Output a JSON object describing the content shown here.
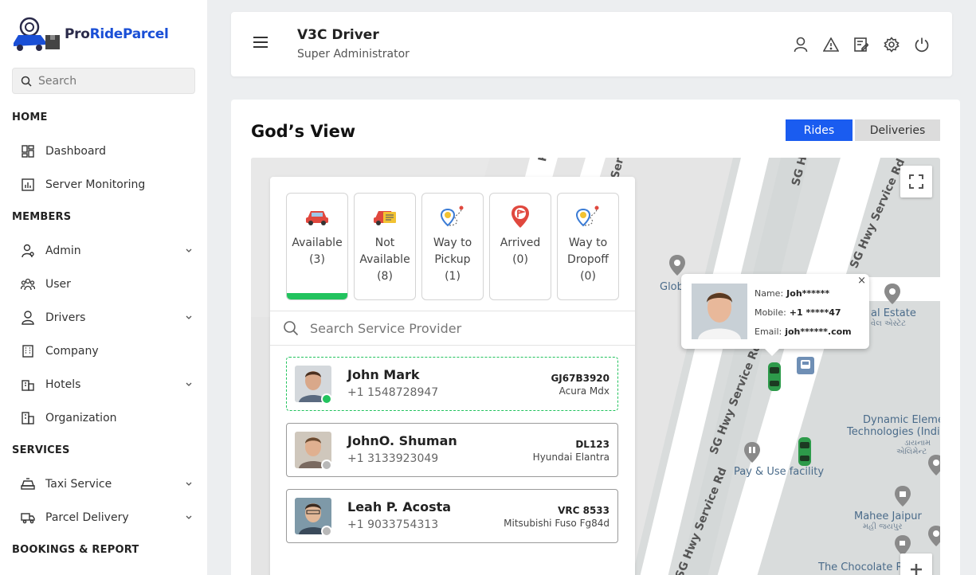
{
  "brand": {
    "part1": "Pro",
    "part2": "RideParcel"
  },
  "sidebar": {
    "search_placeholder": "Search",
    "sections": {
      "home": "HOME",
      "members": "MEMBERS",
      "services": "SERVICES",
      "bookings": "BOOKINGS & REPORT"
    },
    "items": {
      "dashboard": "Dashboard",
      "server_monitoring": "Server Monitoring",
      "admin": "Admin",
      "user": "User",
      "drivers": "Drivers",
      "company": "Company",
      "hotels": "Hotels",
      "organization": "Organization",
      "taxi_service": "Taxi Service",
      "parcel_delivery": "Parcel Delivery"
    }
  },
  "header": {
    "user_name": "V3C Driver",
    "user_role": "Super Administrator",
    "icons": [
      "user-icon",
      "alert-icon",
      "edit-note-icon",
      "settings-icon",
      "power-icon"
    ]
  },
  "main": {
    "title": "God’s View",
    "toggle": {
      "rides": "Rides",
      "deliveries": "Deliveries",
      "active": "rides"
    }
  },
  "status_tabs": [
    {
      "label": "Available",
      "count": "(3)",
      "active": true
    },
    {
      "label": "Not Available",
      "count": "(8)",
      "active": false
    },
    {
      "label": "Way to Pickup",
      "count": "(1)",
      "active": false
    },
    {
      "label": "Arrived",
      "count": "(0)",
      "active": false
    },
    {
      "label": "Way to Dropoff",
      "count": "(0)",
      "active": false
    }
  ],
  "provider_search": {
    "placeholder": "Search Service Provider"
  },
  "drivers": [
    {
      "name": "John Mark",
      "phone": "+1 1548728947",
      "plate": "GJ67B3920",
      "car": "Acura Mdx",
      "online": true
    },
    {
      "name": "JohnO. Shuman",
      "phone": "+1 3133923049",
      "plate": "DL123",
      "car": "Hyundai Elantra",
      "online": false
    },
    {
      "name": "Leah P. Acosta",
      "phone": "+1 9033754313",
      "plate": "VRC 8533",
      "car": "Mitsubishi Fuso Fg84d",
      "online": false
    }
  ],
  "popup": {
    "name_label": "Name:",
    "name_value": "Joh******",
    "mobile_label": "Mobile:",
    "mobile_value": "+1 *****47",
    "email_label": "Email:",
    "email_value": "joh******.com",
    "close": "×"
  },
  "map_labels": {
    "glob": "Glob",
    "estate": "al Estate",
    "estate_local": "વેલ એસ્ટેટ",
    "dynamic": "Dynamic Eleme",
    "technologies": "Technologies (India",
    "dynamic_local": "એલિમેન્ટ",
    "dynamic_local2": "ડાયનામ",
    "pay_use": "Pay & Use facility",
    "mahee": "Mahee Jaipur",
    "mahee_local": "મહી જયપુર",
    "chocolate": "The Chocolate R",
    "road1": "SG Hwy Service Rd",
    "road2": "SG Hwy Service Rd",
    "road3": "SG Hwy Service Rd",
    "road_top1": "Rd",
    "road_top2": "Ser",
    "road_top3": "SG H"
  }
}
